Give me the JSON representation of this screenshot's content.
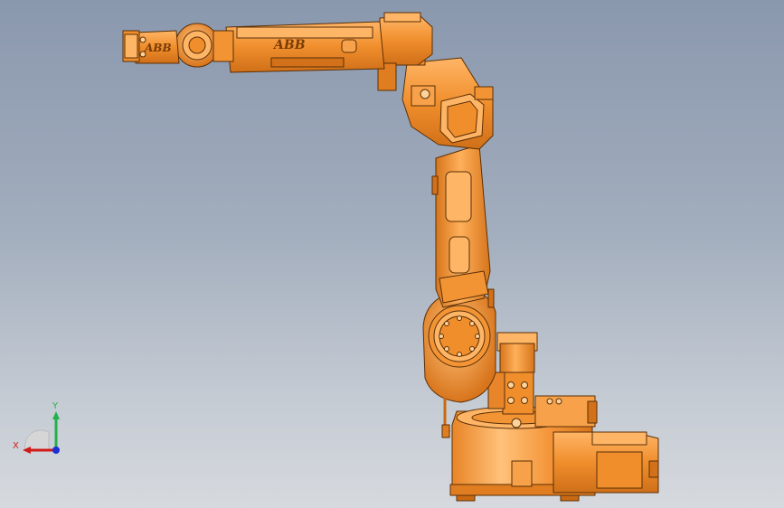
{
  "model": {
    "logos": [
      "ABB",
      "ABB"
    ]
  },
  "triad": {
    "x_label": "X",
    "y_label": "Y",
    "x_color": "#d11a1a",
    "y_color": "#22b14c",
    "z_color": "#1b2fd6"
  },
  "colors": {
    "body": "#f08e2c",
    "body_dark": "#c96a12",
    "body_light": "#ffb866",
    "edge": "#5a2f07",
    "background_top": "#8a98ae",
    "background_bottom": "#d6d9de"
  },
  "icons": [
    "abb-robot-model",
    "coordinate-triad-icon"
  ]
}
